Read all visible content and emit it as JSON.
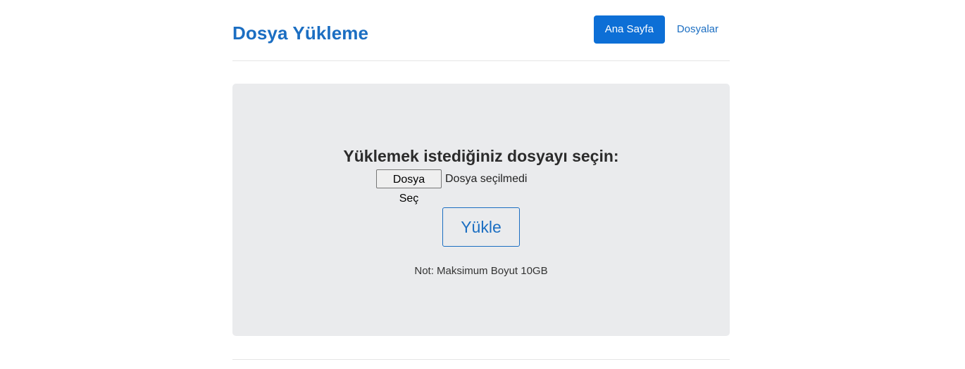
{
  "header": {
    "brand": "Dosya Yükleme",
    "nav": {
      "home": "Ana Sayfa",
      "files": "Dosyalar"
    }
  },
  "upload": {
    "prompt": "Yüklemek istediğiniz dosyayı seçin:",
    "choose_file_label": "Dosya Seç",
    "file_status": "Dosya seçilmedi",
    "submit_label": "Yükle",
    "note": "Not: Maksimum Boyut 10GB"
  },
  "colors": {
    "accent": "#1b6ec2",
    "active_nav_bg": "#0d6fd6",
    "panel_bg": "#eaebed"
  }
}
